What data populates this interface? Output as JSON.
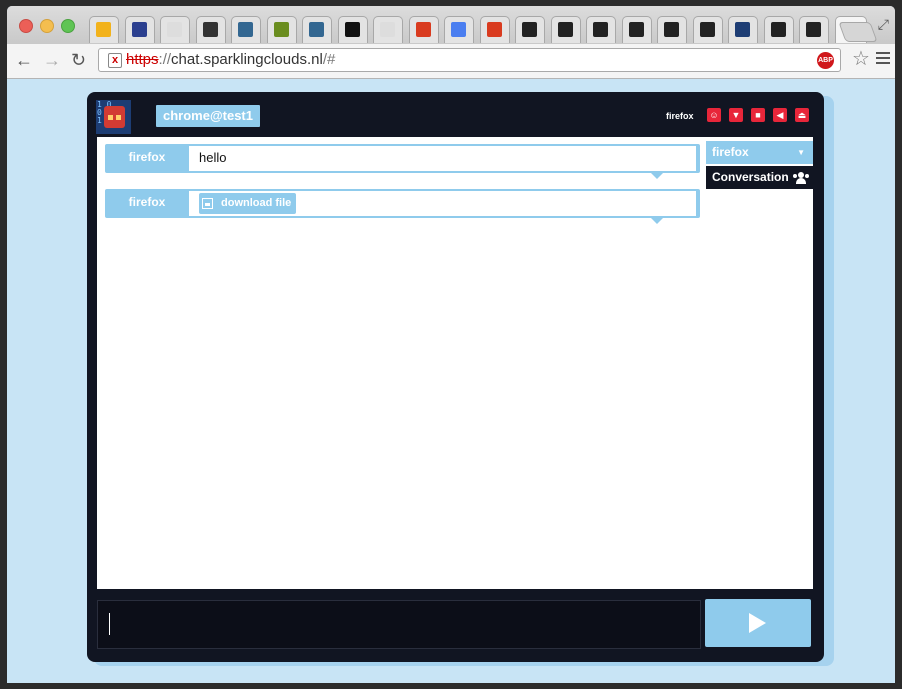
{
  "browser": {
    "tabs": [
      {
        "icon": "outlook-icon",
        "color": "#f2b21b"
      },
      {
        "icon": "tools-icon",
        "color": "#2b3f8f"
      },
      {
        "icon": "page-icon",
        "color": "#dddddd"
      },
      {
        "icon": "linux-penguin-icon",
        "color": "#333333"
      },
      {
        "icon": "postgres-elephant-icon",
        "color": "#336791"
      },
      {
        "icon": "owl-icon",
        "color": "#6a8d1f"
      },
      {
        "icon": "postgres-elephant-icon",
        "color": "#336791"
      },
      {
        "icon": "dollar-one-icon",
        "color": "#111111"
      },
      {
        "icon": "page-icon",
        "color": "#dddddd"
      },
      {
        "icon": "star-icon",
        "color": "#d93b1f"
      },
      {
        "icon": "google-icon",
        "color": "#4a7ef0"
      },
      {
        "icon": "star-icon",
        "color": "#d93b1f"
      },
      {
        "icon": "github-icon",
        "color": "#222222"
      },
      {
        "icon": "github-icon",
        "color": "#222222"
      },
      {
        "icon": "github-icon",
        "color": "#222222"
      },
      {
        "icon": "github-icon",
        "color": "#222222"
      },
      {
        "icon": "github-icon",
        "color": "#222222"
      },
      {
        "icon": "github-icon",
        "color": "#222222"
      },
      {
        "icon": "pixel-avatar-icon",
        "color": "#1d3d74"
      },
      {
        "icon": "github-icon",
        "color": "#222222"
      },
      {
        "icon": "github-icon",
        "color": "#222222"
      }
    ],
    "active_tab_close": "×",
    "url_scheme": "https",
    "url_sep": "://",
    "url_host": "chat.sparklingclouds.nl",
    "url_rest": "/#",
    "abp_label": "ABP"
  },
  "chat": {
    "current_user": "chrome@test1",
    "peer_name": "firefox",
    "header_icons": [
      "face-icon",
      "glass-icon",
      "speech-bubble-icon",
      "speaker-icon",
      "eject-icon"
    ],
    "messages": [
      {
        "sender": "firefox",
        "text": "hello"
      },
      {
        "sender": "firefox",
        "attachment_label": "download file"
      }
    ],
    "sidebar": {
      "selected_peer": "firefox",
      "conversation_label": "Conversation"
    },
    "composer_value": ""
  },
  "colors": {
    "accent": "#8fcbec",
    "app_background": "#111522",
    "page_background": "#c8e4f5",
    "icon_red": "#e8263a"
  }
}
